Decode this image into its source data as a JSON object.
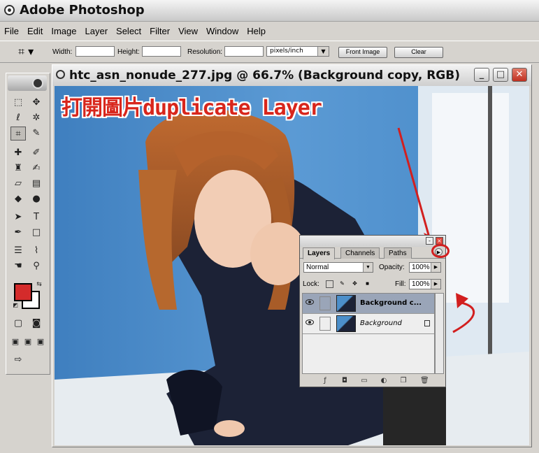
{
  "app": {
    "title": "Adobe Photoshop"
  },
  "menu": [
    "File",
    "Edit",
    "Image",
    "Layer",
    "Select",
    "Filter",
    "View",
    "Window",
    "Help"
  ],
  "options": {
    "width_label": "Width:",
    "height_label": "Height:",
    "resolution_label": "Resolution:",
    "units": "pixels/inch",
    "front_image": "Front Image",
    "clear": "Clear"
  },
  "document": {
    "title": "htc_asn_nonude_277.jpg @ 66.7% (Background copy, RGB)"
  },
  "annotation": "打開圖片duplicate Layer",
  "layers_panel": {
    "tabs": [
      "Layers",
      "Channels",
      "Paths"
    ],
    "blend_mode": "Normal",
    "opacity_label": "Opacity:",
    "opacity": "100%",
    "lock_label": "Lock:",
    "fill_label": "Fill:",
    "fill": "100%",
    "layers": [
      {
        "name": "Background c...",
        "active": true
      },
      {
        "name": "Background",
        "active": false,
        "italic": true
      }
    ]
  },
  "colors": {
    "foreground": "#d42b2b",
    "background": "#ffffff",
    "annotation": "#d8261c"
  }
}
